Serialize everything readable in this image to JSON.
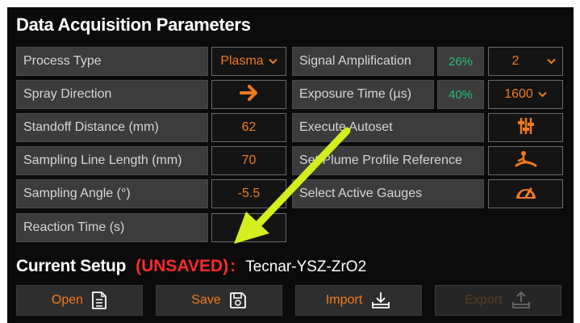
{
  "panel": {
    "title": "Data Acquisition Parameters"
  },
  "left_params": [
    {
      "label": "Process Type",
      "value": "Plasma",
      "dropdown": true
    },
    {
      "label": "Spray Direction",
      "value": "",
      "icon": "arrow-right-icon"
    },
    {
      "label": "Standoff Distance (mm)",
      "value": "62"
    },
    {
      "label": "Sampling Line Length (mm)",
      "value": "70"
    },
    {
      "label": "Sampling Angle (°)",
      "value": "-5.5"
    },
    {
      "label": "Reaction Time (s)",
      "value": ""
    }
  ],
  "right_params": [
    {
      "label": "Signal Amplification",
      "percent": "26%",
      "value": "2",
      "dropdown": true
    },
    {
      "label": "Exposure Time (µs)",
      "percent": "40%",
      "value": "1600",
      "dropdown": true
    },
    {
      "label": "Execute Autoset",
      "icon": "autoset-sliders-icon"
    },
    {
      "label": "Set Plume Profile Reference",
      "icon": "plume-profile-icon"
    },
    {
      "label": "Select Active Gauges",
      "icon": "gauge-icon"
    }
  ],
  "setup": {
    "label": "Current Setup",
    "status": "(UNSAVED)",
    "colon": ":",
    "name": "Tecnar-YSZ-ZrO2"
  },
  "buttons": {
    "open": "Open",
    "save": "Save",
    "import": "Import",
    "export": "Export"
  },
  "colors": {
    "accent": "#f07a1e",
    "percent": "#22c07a",
    "unsaved": "#ff2a2a",
    "annotation_arrow": "#d4ee1f"
  }
}
